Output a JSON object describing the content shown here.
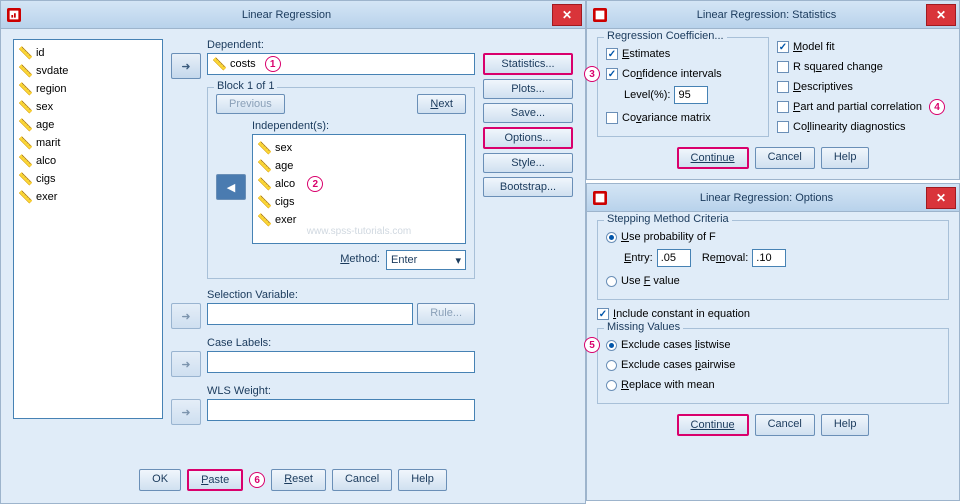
{
  "main": {
    "title": "Linear Regression",
    "vars": [
      "id",
      "svdate",
      "region",
      "sex",
      "age",
      "marit",
      "alco",
      "cigs",
      "exer"
    ],
    "dependent_label": "Dependent:",
    "dependent_value": "costs",
    "block_title": "Block 1 of 1",
    "previous": "Previous",
    "next": "Next",
    "independents_label": "Independent(s):",
    "independents": [
      "sex",
      "age",
      "alco",
      "cigs",
      "exer"
    ],
    "watermark": "www.spss-tutorials.com",
    "method_label": "Method:",
    "method_value": "Enter",
    "selection_label": "Selection Variable:",
    "rule": "Rule...",
    "case_labels": "Case Labels:",
    "wls_label": "WLS Weight:",
    "side_buttons": [
      "Statistics...",
      "Plots...",
      "Save...",
      "Options...",
      "Style...",
      "Bootstrap..."
    ],
    "bottom": {
      "ok": "OK",
      "paste": "Paste",
      "reset": "Reset",
      "cancel": "Cancel",
      "help": "Help"
    }
  },
  "stats": {
    "title": "Linear Regression: Statistics",
    "coef_title": "Regression Coefficien...",
    "estimates": "Estimates",
    "ci": "Confidence intervals",
    "level_label": "Level(%):",
    "level_value": "95",
    "cov": "Covariance matrix",
    "model_fit": "Model fit",
    "r2": "R squared change",
    "desc": "Descriptives",
    "partial": "Part and partial correlation",
    "collin": "Collinearity diagnostics",
    "continue": "Continue",
    "cancel": "Cancel",
    "help": "Help"
  },
  "options": {
    "title": "Linear Regression: Options",
    "step_title": "Stepping Method Criteria",
    "use_prob": "Use probability of F",
    "entry_label": "Entry:",
    "entry_value": ".05",
    "removal_label": "Removal:",
    "removal_value": ".10",
    "use_f": "Use F value",
    "include_const": "Include constant in equation",
    "missing_title": "Missing Values",
    "excl_list": "Exclude cases listwise",
    "excl_pair": "Exclude cases pairwise",
    "replace": "Replace with mean",
    "continue": "Continue",
    "cancel": "Cancel",
    "help": "Help"
  },
  "ann": {
    "1": "1",
    "2": "2",
    "3": "3",
    "4": "4",
    "5": "5",
    "6": "6"
  }
}
